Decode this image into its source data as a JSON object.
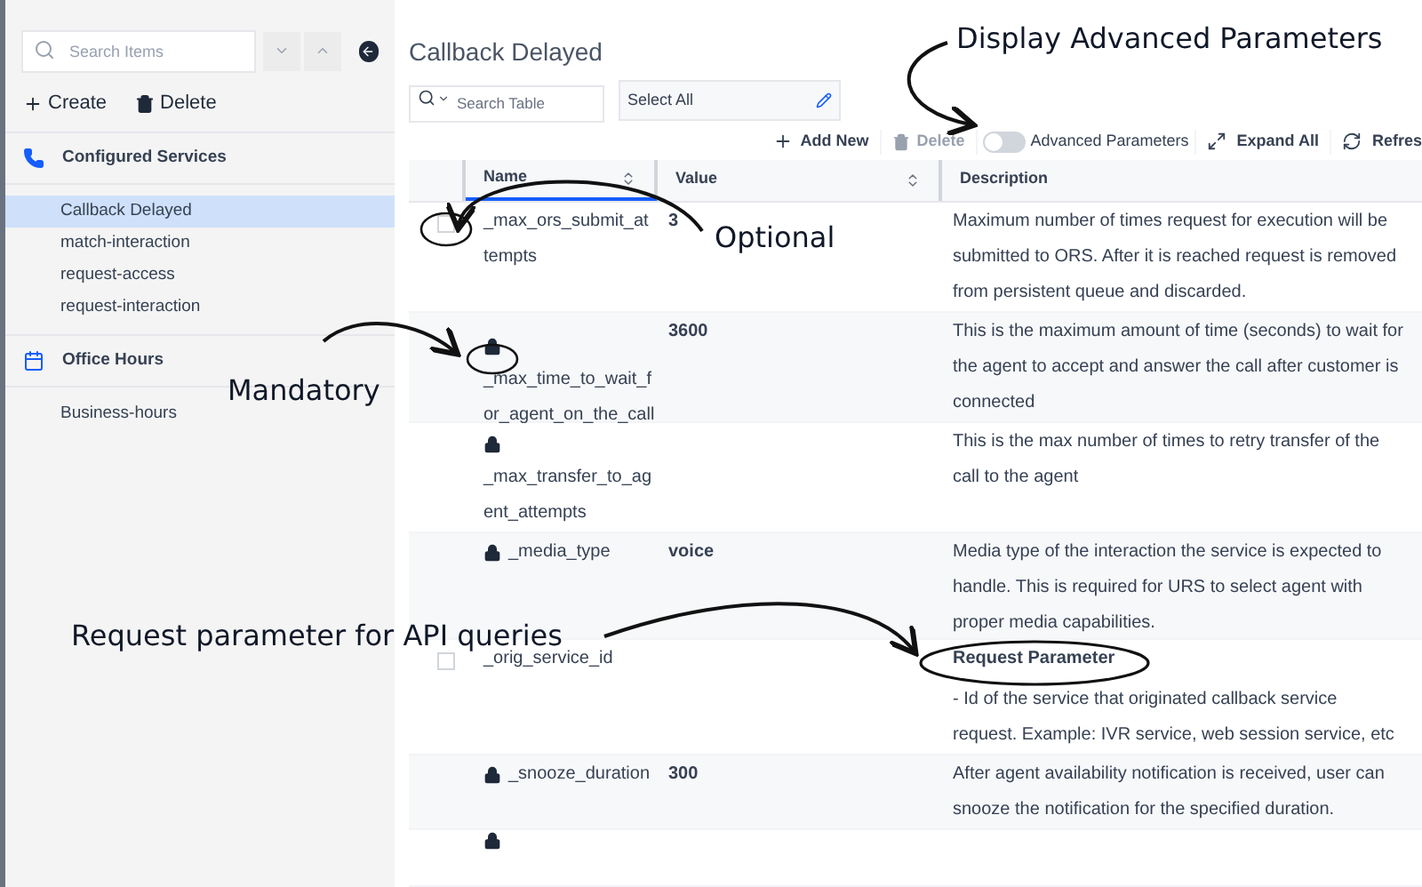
{
  "sidebar": {
    "search": {
      "placeholder": "Search Items"
    },
    "actions": [
      "Create",
      "Delete"
    ],
    "sections": [
      {
        "kind": "phone",
        "title": "Configured Services",
        "items": [
          {
            "label": "Callback Delayed",
            "selected": true
          },
          {
            "label": "match-interaction",
            "selected": false
          },
          {
            "label": "request-access",
            "selected": false
          },
          {
            "label": "request-interaction",
            "selected": false
          }
        ]
      },
      {
        "kind": "calendar",
        "title": "Office Hours",
        "items": [
          {
            "label": "Business-hours",
            "selected": false
          }
        ]
      }
    ]
  },
  "main": {
    "title": "Callback Delayed",
    "table_search": {
      "placeholder": "Search Table"
    },
    "select": {
      "value": "Select All"
    },
    "toolbar": {
      "add": "Add New",
      "delete": {
        "label": "Delete",
        "disabled": true
      },
      "advanced": {
        "label": "Advanced Parameters",
        "on": false
      },
      "expand": "Expand All",
      "refresh": "Refres"
    },
    "table": {
      "columns": [
        "Name",
        "Value",
        "Description"
      ],
      "rows": [
        {
          "kind": "optional",
          "checked": false,
          "name": "_max_ors_submit_at tempts",
          "value": "3",
          "description": "Maximum number of times request for execution will be submitted to ORS. After it is reached request is removed from persistent queue and discarded."
        },
        {
          "kind": "mandatory",
          "name": "_max_time_to_wait_f or_agent_on_the_call",
          "value": "3600",
          "description": "This is the maximum amount of time (seconds) to wait for the agent to accept and answer the call after customer is connected"
        },
        {
          "kind": "mandatory",
          "name": "_max_transfer_to_ag ent_attempts",
          "value": "",
          "description": "This is the max number of times to retry transfer of the call to the agent"
        },
        {
          "kind": "mandatory",
          "name": "_media_type",
          "value": "voice",
          "description": "Media type of the interaction the service is expected to handle. This is required for URS to select agent with proper media capabilities."
        },
        {
          "kind": "optional",
          "checked": false,
          "name": "_orig_service_id",
          "value": "",
          "tag": "Request Parameter",
          "description": "- Id of the service that originated callback service request. Example: IVR service, web session service, etc"
        },
        {
          "kind": "mandatory",
          "name": "_snooze_duration",
          "value": "300",
          "description": "After agent availability notification is received, user can snooze the notification for the specified duration."
        },
        {
          "kind": "mandatory",
          "name": "",
          "value": "",
          "description": ""
        }
      ]
    }
  },
  "annotations": [
    "Display Advanced Parameters",
    "Optional",
    "Mandatory",
    "Request parameter for API queries"
  ]
}
